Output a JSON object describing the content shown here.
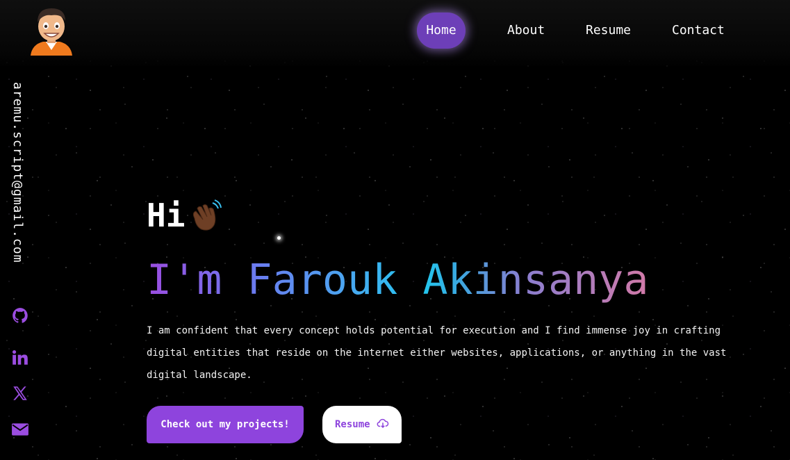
{
  "nav": {
    "items": [
      {
        "label": "Home",
        "active": true
      },
      {
        "label": "About"
      },
      {
        "label": "Resume"
      },
      {
        "label": "Contact"
      }
    ]
  },
  "sidebar": {
    "email": "aremu.script@gmail.com",
    "socials": [
      {
        "icon": "github-icon"
      },
      {
        "icon": "linkedin-icon"
      },
      {
        "icon": "x-twitter-icon"
      },
      {
        "icon": "mail-icon"
      }
    ]
  },
  "hero": {
    "greeting": "Hi",
    "wave_icon": "waving-hand-icon",
    "name": "I'm Farouk Akinsanya",
    "intro": "I am confident that every concept holds potential for execution and I find immense joy in crafting digital entities that reside on the internet either websites, applications, or anything in the vast digital landscape.",
    "primary_button": "Check out my projects!",
    "secondary_button": "Resume",
    "secondary_icon": "cloud-download-icon"
  },
  "colors": {
    "accent": "#8e44dd",
    "nav_active": "#6d3fb8",
    "social_icon": "#9b4de0",
    "background": "#000000"
  }
}
